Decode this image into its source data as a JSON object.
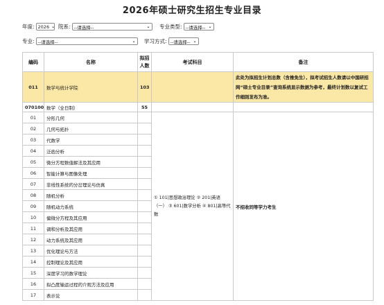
{
  "page": {
    "title": "2026年硕士研究生招生专业目录"
  },
  "filters": {
    "year_label": "年度:",
    "year_value": "2026",
    "dept_label": "院系:",
    "dept_value": "--请选择--",
    "type_label": "专业类型:",
    "type_value": "--请选择--",
    "major_label": "专业:",
    "major_value": "--请选择--",
    "mode_label": "学习方式:",
    "mode_value": "--请选择--"
  },
  "table": {
    "headers": {
      "code": "编码",
      "name": "名称",
      "quota_line1": "拟招",
      "quota_line2": "人数",
      "exam": "考试科目",
      "note": "备注"
    },
    "college": {
      "code": "011",
      "name": "数学与统计学院",
      "quota": "103",
      "note": "此处为拟招生计划总数（含推免生），拟考试招生人数请以中国研招网“硕士专业目录”查询系统显示数据为参考，最终计划数以复试工作细则发布为准。"
    },
    "major": {
      "code": "070100",
      "name": "数学（全日制）",
      "quota": "55"
    },
    "directions": [
      {
        "code": "01",
        "name": "分形几何"
      },
      {
        "code": "02",
        "name": "几何与拓扑"
      },
      {
        "code": "03",
        "name": "代数学"
      },
      {
        "code": "04",
        "name": "泛函分析"
      },
      {
        "code": "05",
        "name": "微分方程数值解法及其应用"
      },
      {
        "code": "06",
        "name": "智能计算与图像处理"
      },
      {
        "code": "07",
        "name": "非线性系统的分岔理论与仿真"
      },
      {
        "code": "08",
        "name": "随机分析"
      },
      {
        "code": "09",
        "name": "随机动力系统"
      },
      {
        "code": "10",
        "name": "偏微分方程及其应用"
      },
      {
        "code": "11",
        "name": "调和分析及其应用"
      },
      {
        "code": "12",
        "name": "动力系统及其应用"
      },
      {
        "code": "13",
        "name": "优化理论与方法"
      },
      {
        "code": "14",
        "name": "控制理论及其应用"
      },
      {
        "code": "15",
        "name": "深度学习的数学理论"
      },
      {
        "code": "16",
        "name": "拟凸度输运过程的介观方法及应用"
      },
      {
        "code": "17",
        "name": "表示论"
      }
    ],
    "exam_subjects": "① 101|思想政治理论 ② 201|英语（一） ③ 601|数学分析 ④ 801|高等代数",
    "direction_note": "不招收同等学力考生"
  }
}
